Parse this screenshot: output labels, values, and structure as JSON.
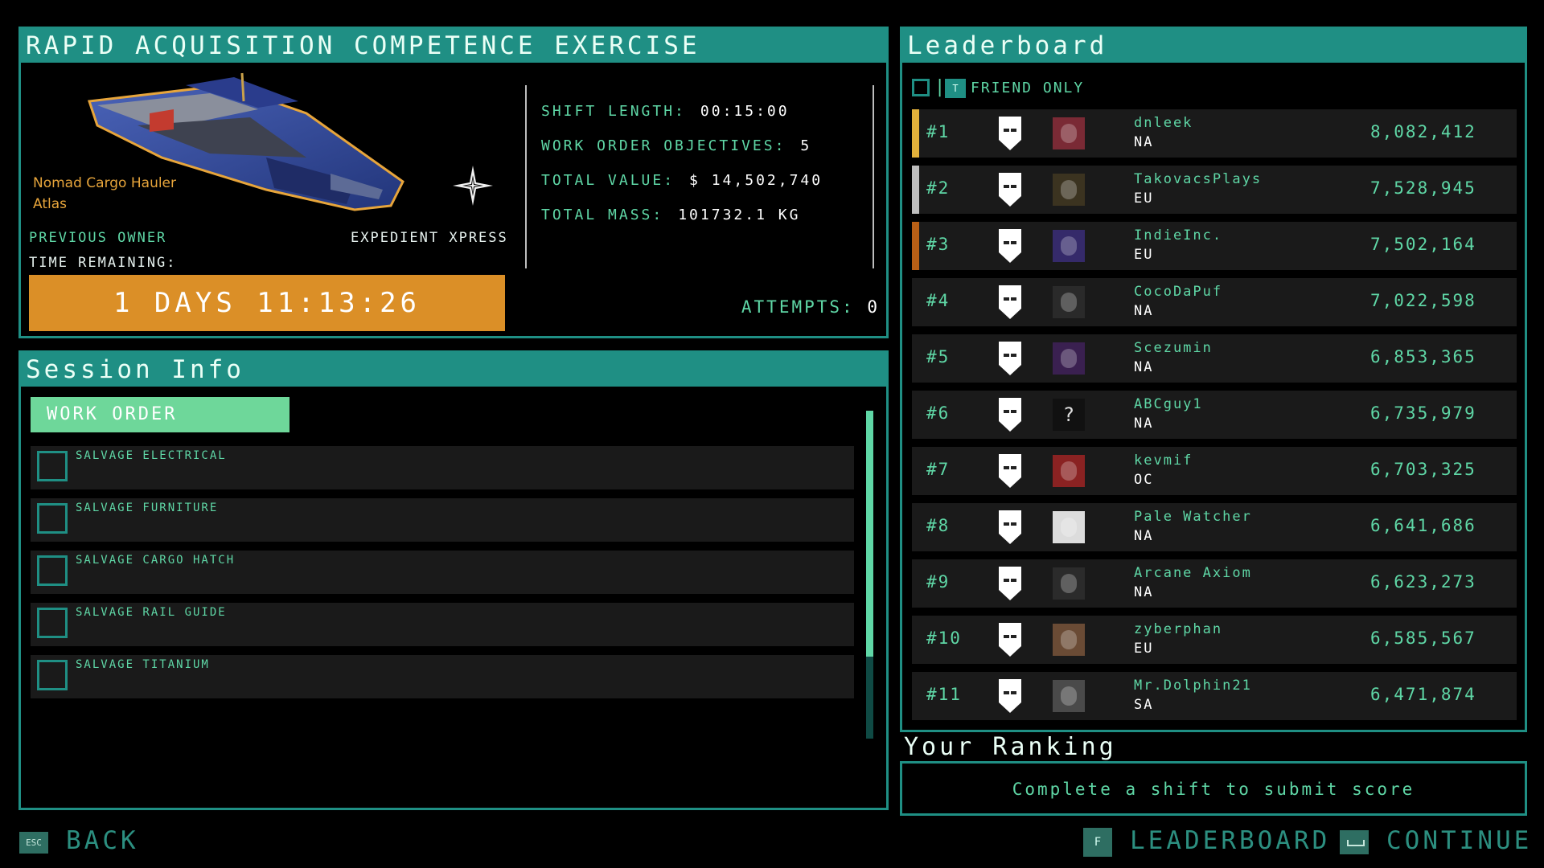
{
  "contract": {
    "title": "RAPID ACQUISITION COMPETENCE EXERCISE",
    "ship_model": "Nomad Cargo Hauler",
    "ship_base": "Atlas",
    "previous_owner_label": "PREVIOUS OWNER",
    "previous_owner_value": "EXPEDIENT XPRESS",
    "time_remaining_label": "TIME REMAINING:",
    "time_remaining_value": "1 DAYS 11:13:26",
    "stats": [
      {
        "label": "SHIFT LENGTH:",
        "value": "00:15:00"
      },
      {
        "label": "WORK ORDER OBJECTIVES:",
        "value": "5"
      },
      {
        "label": "TOTAL VALUE:",
        "value": "$ 14,502,740"
      },
      {
        "label": "TOTAL MASS:",
        "value": "101732.1 KG"
      }
    ],
    "attempts_label": "ATTEMPTS:",
    "attempts_value": "0"
  },
  "session": {
    "title": "Session Info",
    "tab_label": "WORK ORDER",
    "objectives": [
      {
        "label": "SALVAGE ELECTRICAL"
      },
      {
        "label": "SALVAGE FURNITURE"
      },
      {
        "label": "SALVAGE CARGO HATCH"
      },
      {
        "label": "SALVAGE RAIL GUIDE"
      },
      {
        "label": "SALVAGE TITANIUM"
      }
    ],
    "scroll_fraction_visible": 0.75
  },
  "leaderboard": {
    "title": "Leaderboard",
    "friend_key": "T",
    "friend_only_label": "FRIEND ONLY",
    "entries": [
      {
        "rank": "#1",
        "name": "dnleek",
        "region": "NA",
        "score": "8,082,412",
        "accent": "#e3b13b",
        "avatar": "pink-creature-avatar"
      },
      {
        "rank": "#2",
        "name": "TakovacsPlays",
        "region": "EU",
        "score": "7,528,945",
        "accent": "#bdbdbd",
        "avatar": "octopus-avatar"
      },
      {
        "rank": "#3",
        "name": "IndieInc.",
        "region": "EU",
        "score": "7,502,164",
        "accent": "#b85f16",
        "avatar": "robot-figure-avatar"
      },
      {
        "rank": "#4",
        "name": "CocoDaPuf",
        "region": "NA",
        "score": "7,022,598",
        "accent": "",
        "avatar": "bird-avatar"
      },
      {
        "rank": "#5",
        "name": "Scezumin",
        "region": "NA",
        "score": "6,853,365",
        "accent": "",
        "avatar": "purple-creature-avatar"
      },
      {
        "rank": "#6",
        "name": "ABCguy1",
        "region": "NA",
        "score": "6,735,979",
        "accent": "",
        "avatar": "unknown-avatar",
        "avatar_text": "?"
      },
      {
        "rank": "#7",
        "name": "kevmif",
        "region": "OC",
        "score": "6,703,325",
        "accent": "",
        "avatar": "red-portrait-avatar"
      },
      {
        "rank": "#8",
        "name": "Pale Watcher",
        "region": "NA",
        "score": "6,641,686",
        "accent": "",
        "avatar": "skull-avatar"
      },
      {
        "rank": "#9",
        "name": "Arcane Axiom",
        "region": "NA",
        "score": "6,623,273",
        "accent": "",
        "avatar": "helmet-avatar"
      },
      {
        "rank": "#10",
        "name": "zyberphan",
        "region": "EU",
        "score": "6,585,567",
        "accent": "",
        "avatar": "viking-avatar"
      },
      {
        "rank": "#11",
        "name": "Mr.Dolphin21",
        "region": "SA",
        "score": "6,471,874",
        "accent": "",
        "avatar": "blade-avatar"
      }
    ],
    "your_ranking_title": "Your Ranking",
    "your_ranking_text": "Complete a shift to submit score"
  },
  "footer": {
    "back_key": "ESC",
    "back_label": "BACK",
    "leaderboard_key": "F",
    "leaderboard_label": "LEADERBOARD",
    "continue_label": "CONTINUE"
  },
  "colors": {
    "accent_teal": "#1f8f84",
    "text_green": "#5fd7a6",
    "timer_orange": "#db8f27",
    "tab_green": "#6ed79a",
    "gold": "#e3b13b",
    "silver": "#bdbdbd",
    "bronze": "#b85f16"
  }
}
